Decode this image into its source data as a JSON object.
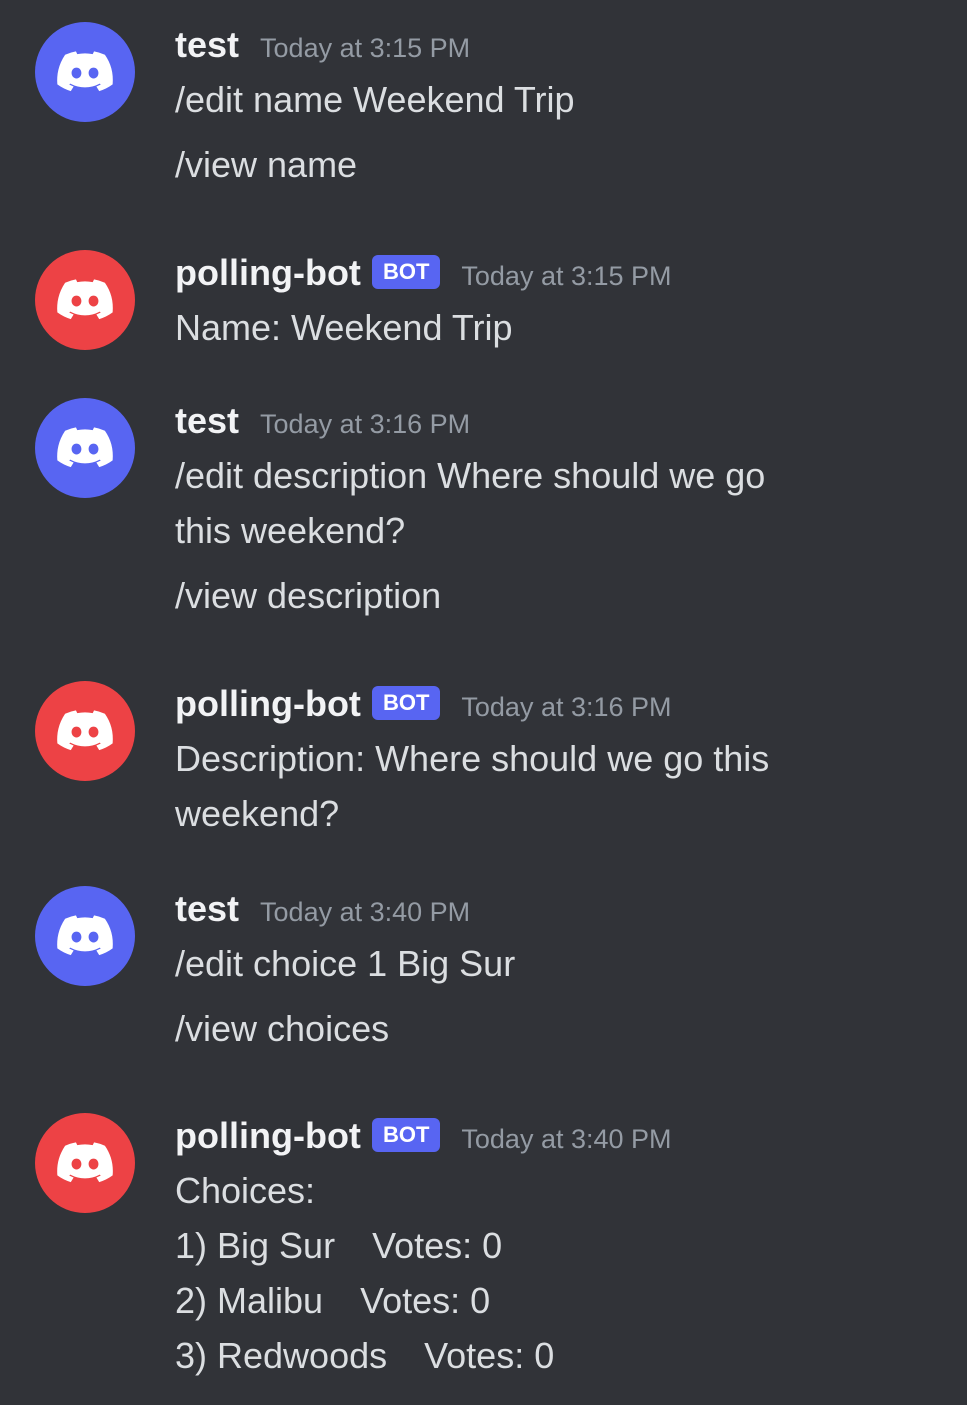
{
  "colors": {
    "user_avatar": "#5865f2",
    "bot_avatar": "#ed4245",
    "badge": "#5865f2",
    "background": "#313338"
  },
  "messages": [
    {
      "author": "test",
      "timestamp": "Today at 3:15 PM",
      "avatar_icon": "discord-logo-icon",
      "lines": [
        "/edit name Weekend Trip",
        "/view name"
      ]
    },
    {
      "author": "polling-bot",
      "badge": "BOT",
      "timestamp": "Today at 3:15 PM",
      "avatar_icon": "discord-logo-icon",
      "lines": [
        "Name: Weekend Trip"
      ]
    },
    {
      "author": "test",
      "timestamp": "Today at 3:16 PM",
      "avatar_icon": "discord-logo-icon",
      "lines": [
        "/edit description Where should we go",
        "this weekend?",
        "/view description"
      ]
    },
    {
      "author": "polling-bot",
      "badge": "BOT",
      "timestamp": "Today at 3:16 PM",
      "avatar_icon": "discord-logo-icon",
      "lines": [
        "Description: Where should we go this",
        "weekend?"
      ]
    },
    {
      "author": "test",
      "timestamp": "Today at 3:40 PM",
      "avatar_icon": "discord-logo-icon",
      "lines": [
        "/edit choice 1 Big Sur",
        "/view choices"
      ]
    },
    {
      "author": "polling-bot",
      "badge": "BOT",
      "timestamp": "Today at 3:40 PM",
      "avatar_icon": "discord-logo-icon",
      "lines": [
        "Choices:"
      ],
      "choices": [
        {
          "label": "1) Big Sur",
          "votes": "Votes: 0"
        },
        {
          "label": "2) Malibu",
          "votes": "Votes: 0"
        },
        {
          "label": "3) Redwoods",
          "votes": "Votes: 0"
        }
      ]
    }
  ]
}
